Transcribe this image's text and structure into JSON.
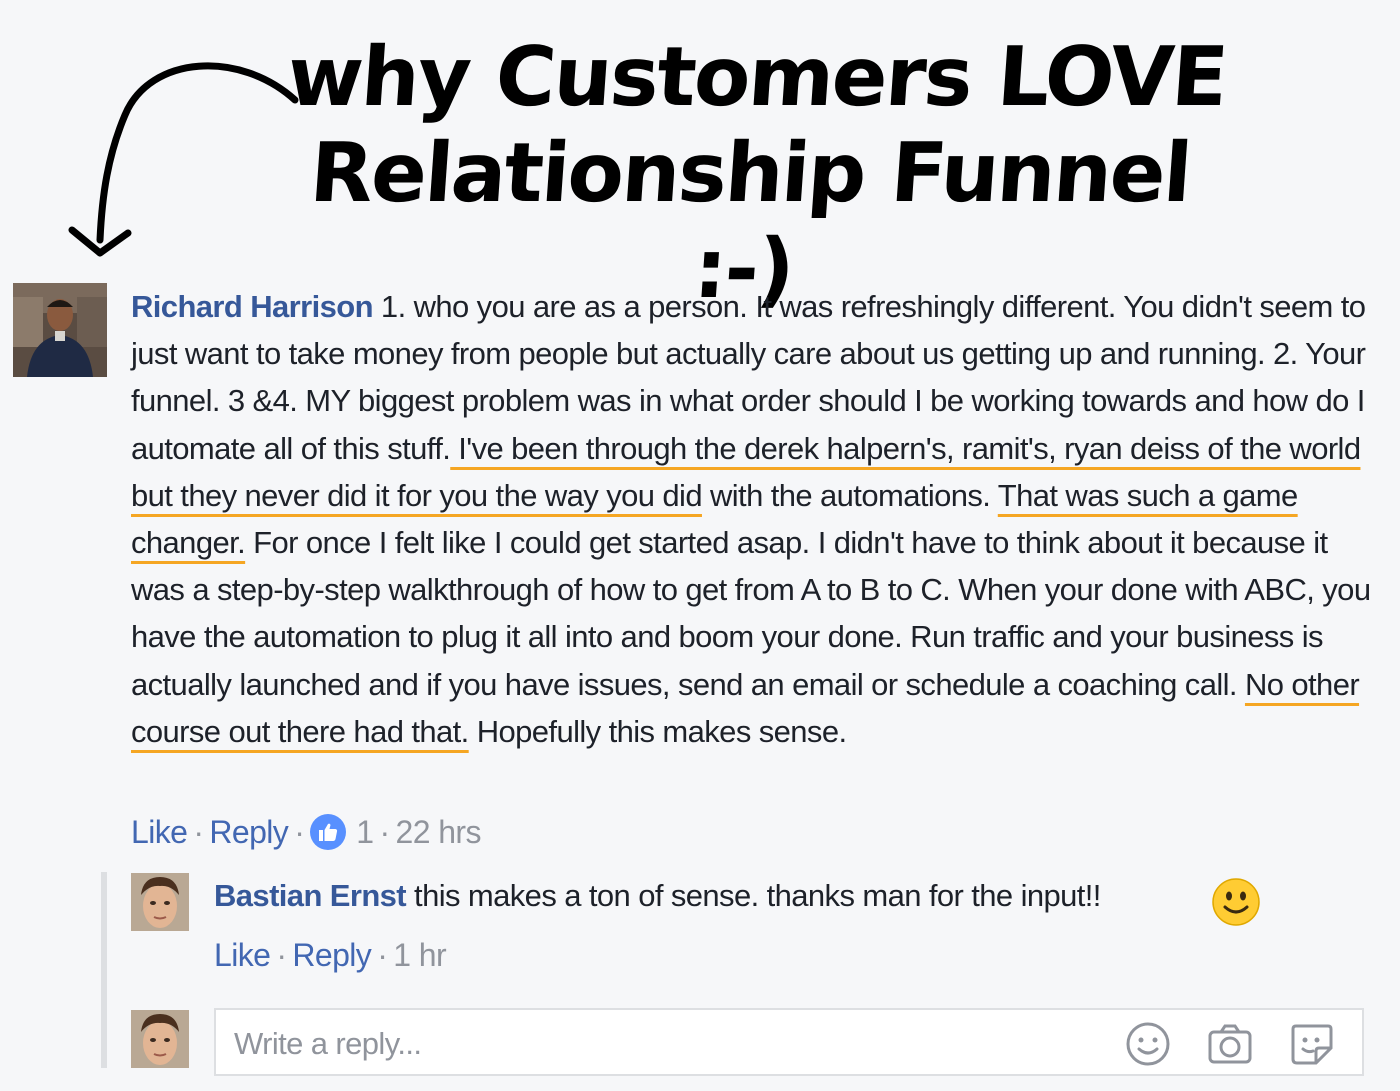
{
  "headline": {
    "line1": "why Customers LOVE",
    "line2": "Relationship Funnel :-)"
  },
  "comment": {
    "author": "Richard Harrison",
    "segments": [
      {
        "text": " 1. who you are as a person. It was refreshingly different. You didn't seem to just want to take money from people but actually care about us getting up and running. 2. Your funnel. 3 &4. MY biggest problem was in what order should I be working towards and how do I automate all of this stuff.",
        "highlight": false
      },
      {
        "text": " I've been through the derek halpern's, ramit's, ryan deiss of the world but they never did it for you the way you did",
        "highlight": true
      },
      {
        "text": " with the automations. ",
        "highlight": false
      },
      {
        "text": "That was such a game changer.",
        "highlight": true
      },
      {
        "text": " For once I felt like I could get started asap. I didn't have to think about it because it was a step-by-step walkthrough of how to get from A to B to C. When your done with ABC, you have the automation to plug it all into and boom your done. Run traffic and your business is actually launched and if you have issues, send an email or schedule a coaching call. ",
        "highlight": false
      },
      {
        "text": "No other course out there had that.",
        "highlight": true
      },
      {
        "text": " Hopefully this makes sense.",
        "highlight": false
      }
    ],
    "like_label": "Like",
    "reply_label": "Reply",
    "reaction_count": "1",
    "time": "22 hrs",
    "highlight_color": "#f5a623"
  },
  "reply": {
    "author": "Bastian Ernst",
    "text": " this makes a ton of sense. thanks man for the input!!",
    "emoji": "smile-emoji",
    "like_label": "Like",
    "reply_label": "Reply",
    "time": "1 hr"
  },
  "composer": {
    "placeholder": "Write a reply...",
    "icons": [
      "emoji-icon",
      "camera-icon",
      "sticker-icon"
    ]
  },
  "colors": {
    "author": "#365899",
    "link": "#4267b2",
    "meta": "#90949c",
    "background": "#f6f7f9"
  }
}
